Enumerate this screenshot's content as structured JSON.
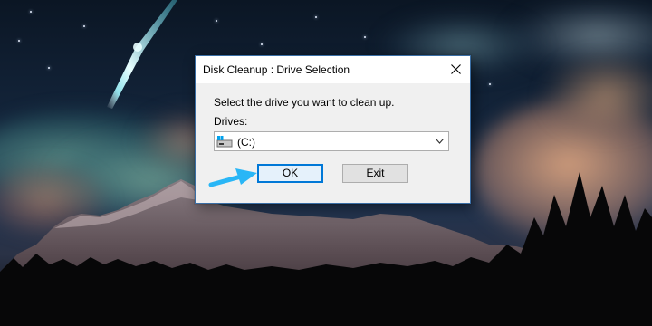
{
  "dialog": {
    "title": "Disk Cleanup : Drive Selection",
    "prompt": "Select the drive you want to clean up.",
    "drives_label": "Drives:",
    "selected_drive": "(C:)",
    "ok_label": "OK",
    "exit_label": "Exit"
  },
  "icons": {
    "close": "close-icon",
    "drive": "windows-drive-icon",
    "dropdown": "chevron-down-icon",
    "pointer": "arrow-pointer-icon"
  },
  "colors": {
    "accent": "#0078d7",
    "arrow": "#29b6f6",
    "dialog_bg": "#f0f0f0"
  }
}
